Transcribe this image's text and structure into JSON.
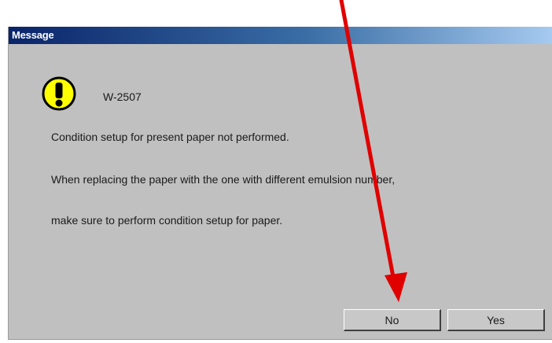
{
  "dialog": {
    "title": "Message",
    "icon": "warning-exclamation-icon",
    "code": "W-2507",
    "lines": [
      "Condition setup for present paper not performed.",
      "When replacing the paper with the one with different emulsion number,",
      "make sure to perform condition setup for paper."
    ],
    "buttons": {
      "no_label": "No",
      "yes_label": "Yes"
    }
  },
  "annotation": {
    "type": "red-arrow",
    "color": "#e00000",
    "points_to": "no-button"
  },
  "colors": {
    "dialog_bg": "#c0c0c0",
    "titlebar_start": "#0a246a",
    "titlebar_end": "#a6caf0",
    "icon_yellow": "#ffff00"
  }
}
